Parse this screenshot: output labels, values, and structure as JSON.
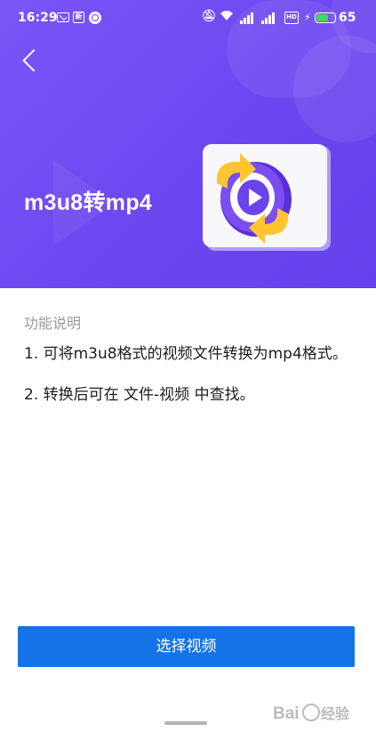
{
  "status_bar": {
    "time": "16:29",
    "news_icon_text": "新",
    "hd_icon_text": "HD",
    "battery_level": 65,
    "battery_text": "65",
    "battery_color": "#3ddc5a"
  },
  "header": {
    "title": "m3u8转mp4",
    "background_color": "#6e49f1"
  },
  "description": {
    "heading": "功能说明",
    "items": [
      "1. 可将m3u8格式的视频文件转换为mp4格式。",
      "2. 转换后可在 文件-视频 中查找。"
    ]
  },
  "actions": {
    "select_video_label": "选择视频",
    "button_color": "#1473e6"
  },
  "watermark": {
    "text": "Bai 经验"
  }
}
